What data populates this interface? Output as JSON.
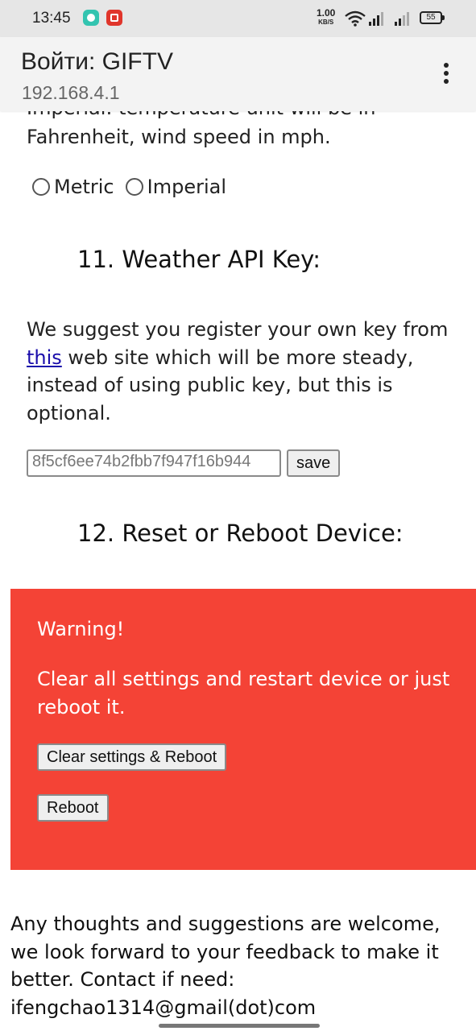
{
  "status_bar": {
    "time": "13:45",
    "net_speed_value": "1.00",
    "net_speed_unit": "KB/S",
    "battery": "55",
    "icons": [
      "app-notification-icon",
      "app-notification-icon",
      "wifi-icon",
      "signal-icon",
      "signal-icon",
      "battery-icon"
    ]
  },
  "browser": {
    "title": "Войти: GIFTV",
    "url": "192.168.4.1",
    "menu_icon": "more-vert-icon"
  },
  "units": {
    "cut_line": "Imperial: temperature unit will be in",
    "line2": "Fahrenheit, wind speed in mph.",
    "options": [
      "Metric",
      "Imperial"
    ]
  },
  "section11": {
    "heading": "11. Weather API Key:",
    "para_before_link": "We suggest you register your own key from ",
    "link": "this",
    "para_after_link": " web site which will be more steady, instead of using public key, but this is optional.",
    "api_key_value": "8f5cf6ee74b2fbb7f947f16b944",
    "save_label": "save"
  },
  "section12": {
    "heading": "12. Reset or Reboot Device:",
    "warning_title": "Warning!",
    "warning_text": "Clear all settings and restart device or just reboot it.",
    "clear_button": "Clear settings & Reboot",
    "reboot_button": "Reboot",
    "warning_color": "#f44336"
  },
  "footer": {
    "text": "Any thoughts and suggestions are welcome, we look forward to your feedback to make it better. Contact if need: ifengchao1314@gmail(dot)com"
  }
}
